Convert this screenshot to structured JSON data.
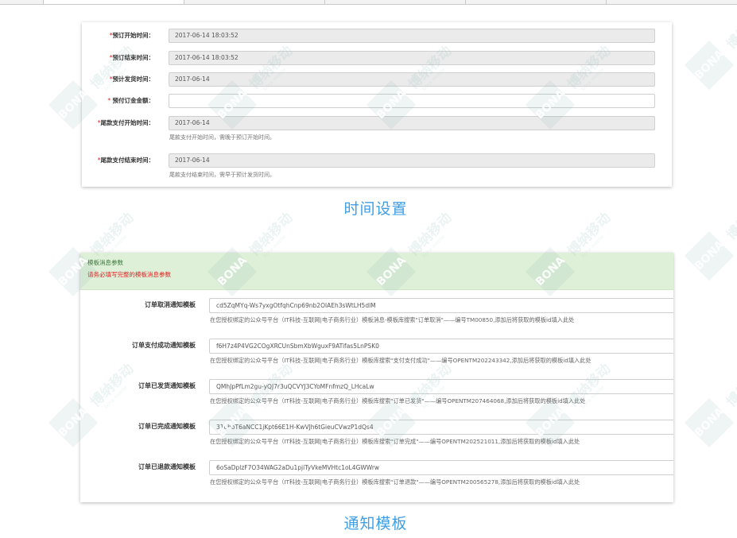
{
  "time_settings": {
    "fields": [
      {
        "label": "预订开始时间：",
        "value": "2017-06-14 18:03:52",
        "hint": ""
      },
      {
        "label": "预订结束时间：",
        "value": "2017-06-14 18:03:52",
        "hint": ""
      },
      {
        "label": "预计发货时间：",
        "value": "2017-06-14",
        "hint": ""
      },
      {
        "label": "预付订金金额：",
        "value": "",
        "hint": ""
      },
      {
        "label": "尾款支付开始时间：",
        "value": "2017-06-14",
        "hint": "尾款支付开始时间，需晚于预订开始时间。"
      },
      {
        "label": "尾款支付结束时间：",
        "value": "2017-06-14",
        "hint": "尾款支付结束时间，需早于预计发货时间。"
      }
    ],
    "caption": "时间设置"
  },
  "template_settings": {
    "notice_title": "模板消息参数",
    "notice_warning": "请务必填写完整的模板消息参数",
    "fields": [
      {
        "label": "订单取消通知模板",
        "value": "cd5ZqMYq-Ws7yxgOtfqhCnp69nb2OlAEh3sWtLH5dlM",
        "hint": "在您授权绑定的公众号平台（IT科技-互联网|电子商务行业）模板消息-模板库搜索\"订单取消\"——编号TM00850,添加后将获取的模板id填入此处"
      },
      {
        "label": "订单支付成功通知模板",
        "value": "f6H7z4P4VG2COgXRCUnSbmXbWguxF9ATifas5LnPSK0",
        "hint": "在您授权绑定的公众号平台（IT科技-互联网|电子商务行业）模板库搜索\"支付支付成功\"——编号OPENTM202243342,添加后将获取的模板id填入此处"
      },
      {
        "label": "订单已发货通知模板",
        "value": "QMhJpPfLm2gu-yQJ7r3uQCVYJ3CYoMFnfmzQ_LHcaLw",
        "hint": "在您授权绑定的公众号平台（IT科技-互联网|电子商务行业）模板库搜索\"订单已发货\"——编号OPENTM207464068,添加后将获取的模板id填入此处"
      },
      {
        "label": "订单已完成通知模板",
        "value": "31oboT6aNCC1jKpt66E1H-KwVJh6tGieuCVwzP1dQs4",
        "hint": "在您授权绑定的公众号平台（IT科技-互联网|电子商务行业）模板库搜索\"订单完成\"——编号OPENTM202521011,添加后将获取的模板id填入此处"
      },
      {
        "label": "订单已退款通知模板",
        "value": "6oSaDplzF7O34WAG2aDu1pjiTyVkeMVHtc1oL4GWWrw",
        "hint": "在您授权绑定的公众号平台（IT科技-互联网|电子商务行业）模板库搜索\"订单退款\"——编号OPENTM200565278,添加后将获取的模板id填入此处"
      }
    ],
    "caption": "通知模板"
  },
  "watermark": {
    "cn": "博纳移动",
    "en": "bona mobile",
    "logo": "BONA"
  },
  "colors": {
    "caption": "#3d9ee6",
    "notice_bg": "#dff0d8",
    "required": "#e02020"
  }
}
